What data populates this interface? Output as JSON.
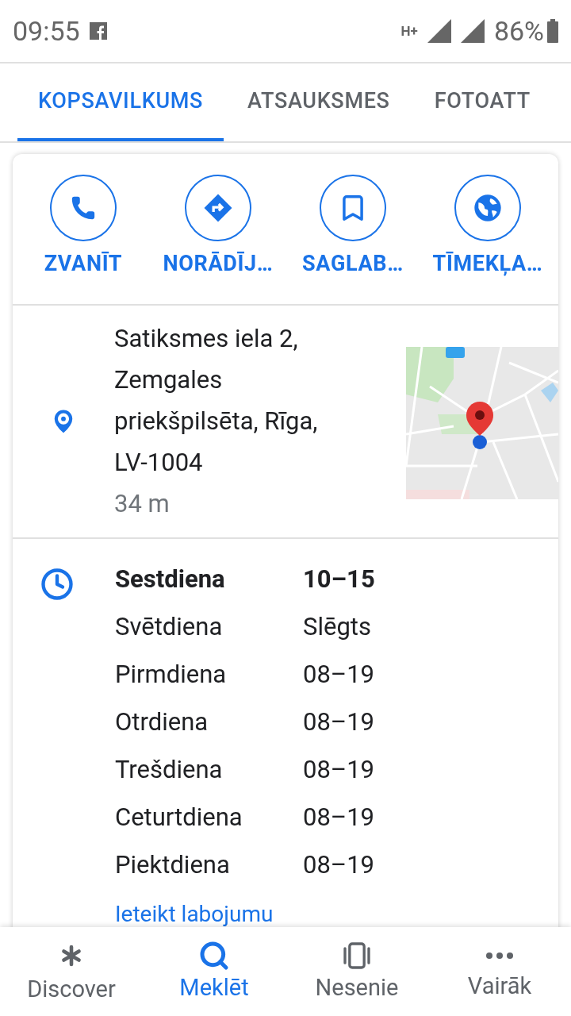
{
  "status_bar": {
    "time": "09:55",
    "network": "H+",
    "battery": "86%"
  },
  "tabs": [
    {
      "label": "KOPSAVILKUMS",
      "selected": true
    },
    {
      "label": "ATSAUKSMES",
      "selected": false
    },
    {
      "label": "FOTOATT",
      "selected": false
    }
  ],
  "actions": [
    {
      "kind": "call",
      "label": "ZVANĪT"
    },
    {
      "kind": "directions",
      "label": "NORĀDĪJ…"
    },
    {
      "kind": "save",
      "label": "SAGLAB…"
    },
    {
      "kind": "website",
      "label": "TĪMEKĻA…"
    }
  ],
  "address": {
    "lines": [
      "Satiksmes iela 2,",
      "Zemgales",
      "priekšpilsēta, Rīga,",
      "LV-1004"
    ],
    "distance": "34 m"
  },
  "hours": [
    {
      "day": "Sestdiena",
      "time": "10–15",
      "today": true
    },
    {
      "day": "Svētdiena",
      "time": "Slēgts",
      "today": false
    },
    {
      "day": "Pirmdiena",
      "time": "08–19",
      "today": false
    },
    {
      "day": "Otrdiena",
      "time": "08–19",
      "today": false
    },
    {
      "day": "Trešdiena",
      "time": "08–19",
      "today": false
    },
    {
      "day": "Ceturtdiena",
      "time": "08–19",
      "today": false
    },
    {
      "day": "Piektdiena",
      "time": "08–19",
      "today": false
    }
  ],
  "suggest_edit": "Ieteikt labojumu",
  "bottom_nav": [
    {
      "kind": "discover",
      "label": "Discover",
      "selected": false
    },
    {
      "kind": "search",
      "label": "Meklēt",
      "selected": true
    },
    {
      "kind": "recent",
      "label": "Nesenie",
      "selected": false
    },
    {
      "kind": "more",
      "label": "Vairāk",
      "selected": false
    }
  ]
}
